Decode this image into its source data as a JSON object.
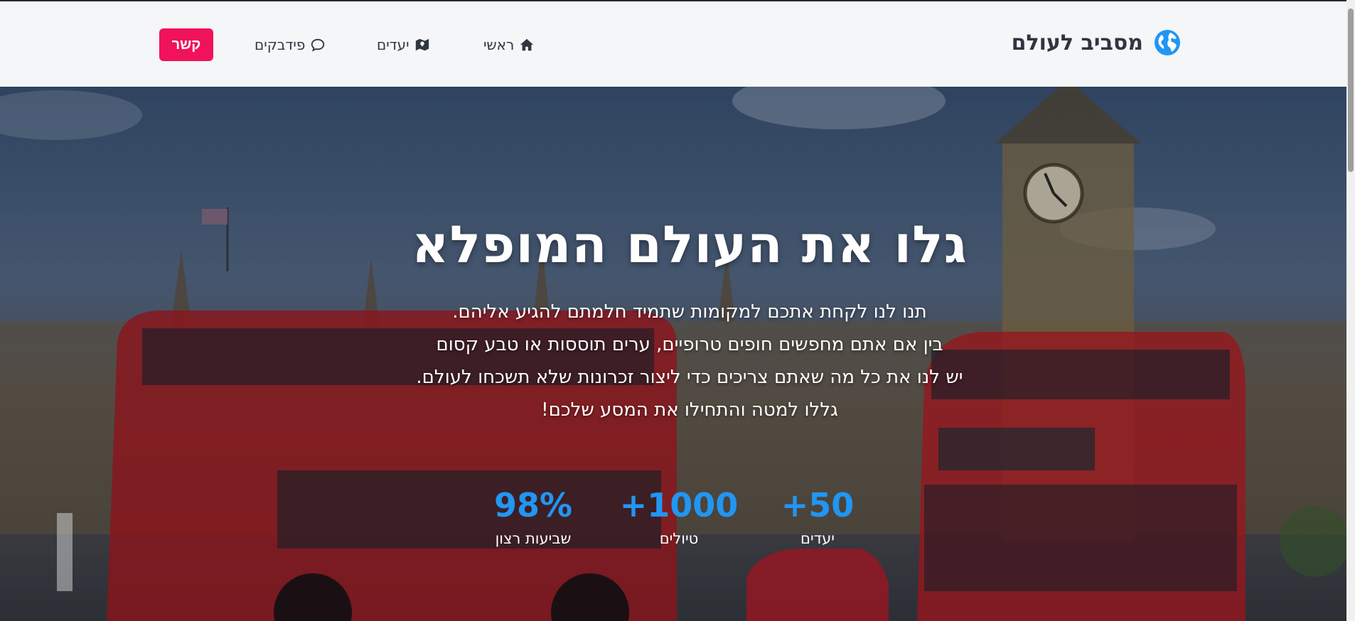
{
  "navbar": {
    "brand": "מסביב לעולם",
    "links": {
      "home": "ראשי",
      "destinations": "יעדים",
      "feedback": "פידבקים"
    },
    "contact_button": "קשר"
  },
  "hero": {
    "title": "גלו את העולם המופלא",
    "lines": [
      "תנו לנו לקחת אתכם למקומות שתמיד חלמתם להגיע אליהם.",
      "בין אם אתם מחפשים חופים טרופיים, ערים תוססות או טבע קסום",
      "יש לנו את כל מה שאתם צריכים כדי ליצור זכרונות שלא תשכחו לעולם.",
      "גללו למטה והתחילו את המסע שלכם!"
    ],
    "stats": [
      {
        "value": "+50",
        "label": "יעדים"
      },
      {
        "value": "+1000",
        "label": "טיולים"
      },
      {
        "value": "98%",
        "label": "שביעות רצון"
      }
    ]
  },
  "colors": {
    "accent": "#2196f3",
    "contact": "#f0125a",
    "nav_bg": "#f4f6f8"
  }
}
